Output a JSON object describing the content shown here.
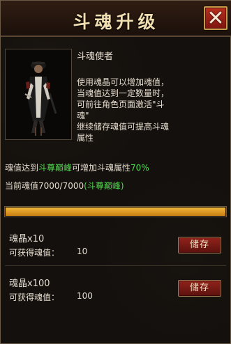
{
  "header": {
    "title": "斗魂升级",
    "close_label": "✕"
  },
  "character": {
    "name": "斗魂使者",
    "description_lines": [
      "使用魂晶可以增加魂值，",
      "当魂值达到一定数量时，",
      "可前往角色页面激活\"斗",
      "魂\"",
      "继续储存魂值可提高斗魂",
      "属性"
    ]
  },
  "effect": {
    "prefix": "魂值达到",
    "rank": "斗尊巅峰",
    "middle": "可增加斗魂属性",
    "percent": "70%"
  },
  "current": {
    "prefix": "当前魂值",
    "value": "7000/7000",
    "rank_bracketed": "(斗尊巅峰)"
  },
  "progress": {
    "current": 7000,
    "max": 7000
  },
  "items": [
    {
      "title": "魂晶x10",
      "gain_label": "可获得魂值：",
      "gain_value": "10",
      "button_label": "储存"
    },
    {
      "title": "魂晶x100",
      "gain_label": "可获得魂值：",
      "gain_value": "100",
      "button_label": "储存"
    }
  ],
  "colors": {
    "accent_green": "#53db4f",
    "progress_fill": "#d89a24",
    "button_red": "#7d140f"
  }
}
